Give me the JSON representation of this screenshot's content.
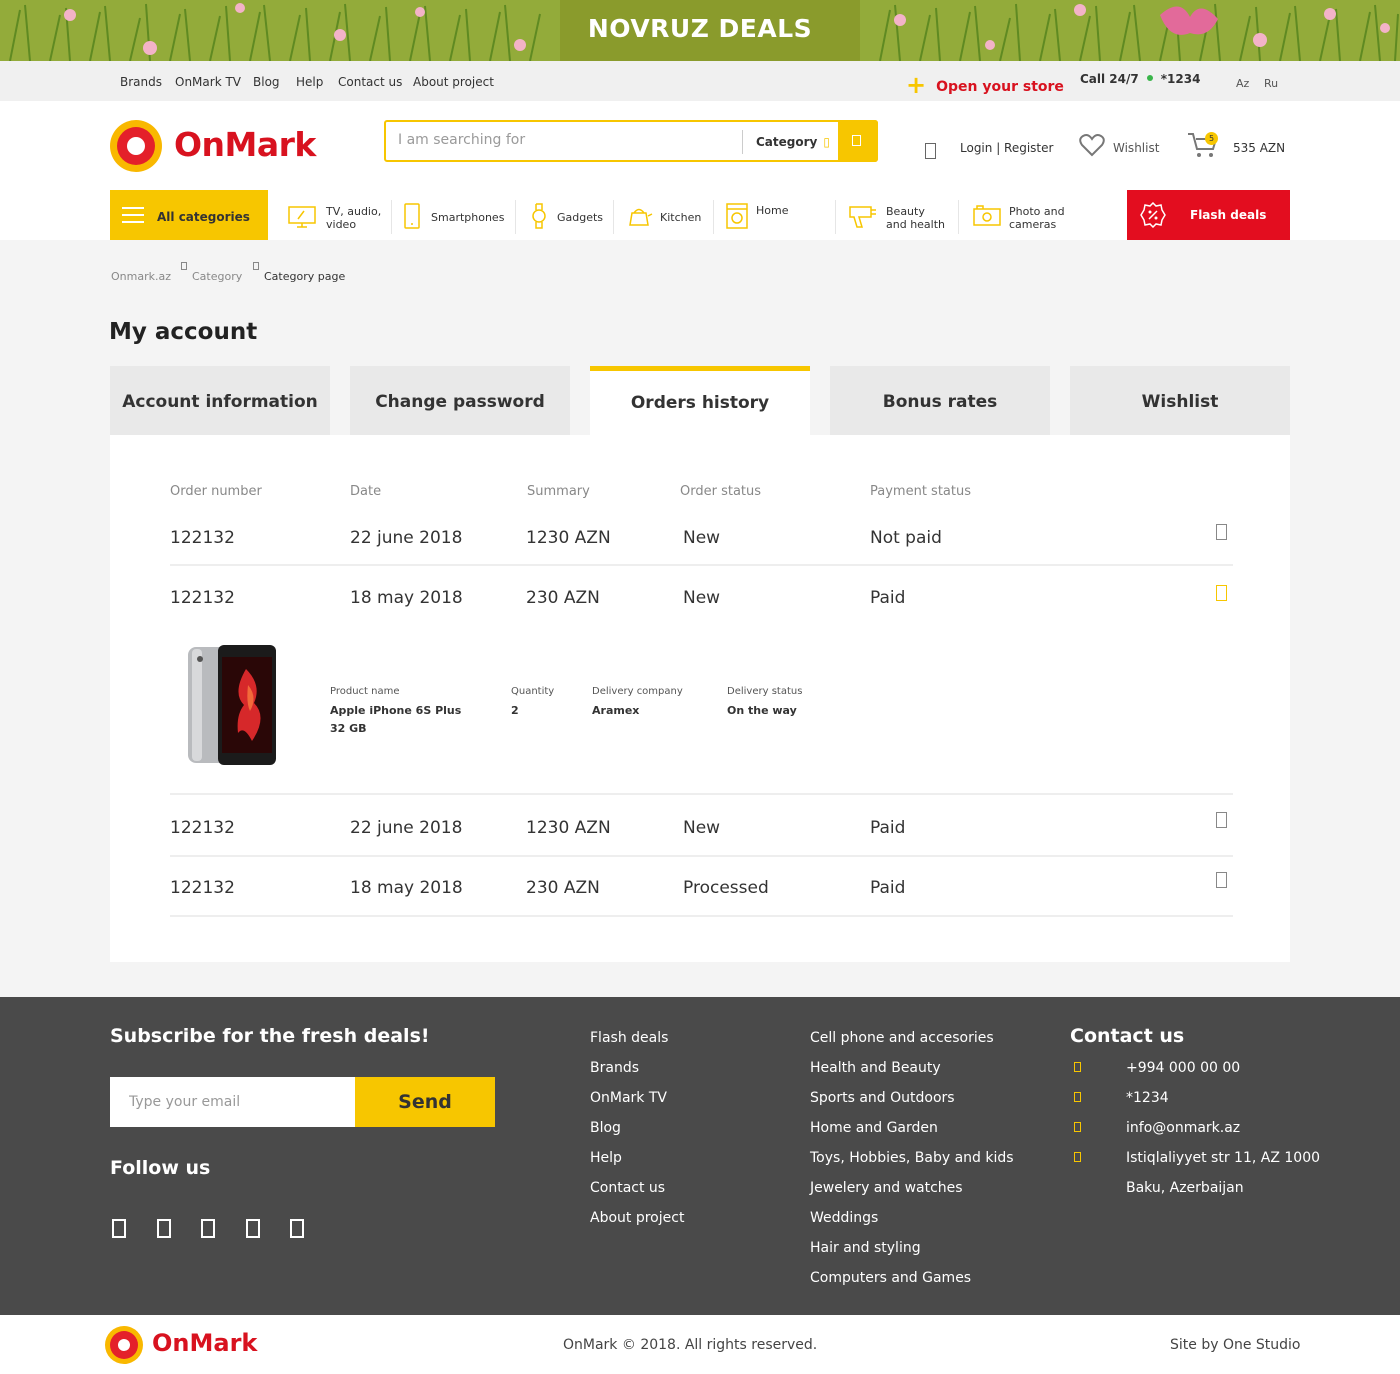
{
  "banner": {
    "title": "NOVRUZ DEALS"
  },
  "topbar": {
    "links": [
      "Brands",
      "OnMark TV",
      "Blog",
      "Help",
      "Contact us",
      "About project"
    ],
    "open_store": "Open your store",
    "call_label": "Call 24/7",
    "call_number": "*1234",
    "languages": [
      "Az",
      "Ru"
    ]
  },
  "header": {
    "logo_text": "OnMark",
    "search_placeholder": "I am searching for",
    "search_category": "Category",
    "login_register": "Login | Register",
    "wishlist": "Wishlist",
    "cart_count": "5",
    "cart_total": "535 AZN"
  },
  "categories": {
    "all_label": "All categories",
    "items": [
      {
        "label": "TV, audio, video",
        "icon": "tv-icon"
      },
      {
        "label": "Smartphones",
        "icon": "smartphone-icon"
      },
      {
        "label": "Gadgets",
        "icon": "watch-icon"
      },
      {
        "label": "Kitchen",
        "icon": "kettle-icon"
      },
      {
        "label": "Home",
        "icon": "washing-machine-icon"
      },
      {
        "label": "Beauty and health",
        "icon": "hair-dryer-icon"
      },
      {
        "label": "Photo and cameras",
        "icon": "camera-icon"
      }
    ],
    "flash_label": "Flash deals"
  },
  "breadcrumb": [
    "Onmark.az",
    "Category",
    "Category page"
  ],
  "page_title": "My account",
  "tabs": [
    "Account information",
    "Change password",
    "Orders history",
    "Bonus rates",
    "Wishlist"
  ],
  "orders": {
    "headers": [
      "Order number",
      "Date",
      "Summary",
      "Order status",
      "Payment status"
    ],
    "rows": [
      {
        "number": "122132",
        "date": "22 june 2018",
        "summary": "1230 AZN",
        "status": "New",
        "payment": "Not paid"
      },
      {
        "number": "122132",
        "date": "18 may 2018",
        "summary": "230 AZN",
        "status": "New",
        "payment": "Paid"
      },
      {
        "number": "122132",
        "date": "22 june 2018",
        "summary": "1230 AZN",
        "status": "New",
        "payment": "Paid"
      },
      {
        "number": "122132",
        "date": "18 may 2018",
        "summary": "230 AZN",
        "status": "Processed",
        "payment": "Paid"
      }
    ],
    "detail": {
      "product_label": "Product name",
      "product_name_1": "Apple iPhone 6S Plus",
      "product_name_2": "32 GB",
      "quantity_label": "Quantity",
      "quantity": "2",
      "company_label": "Delivery company",
      "company": "Aramex",
      "status_label": "Delivery status",
      "status": "On the way"
    }
  },
  "footer": {
    "subscribe_title": "Subscribe for the fresh deals!",
    "email_placeholder": "Type your email",
    "send_label": "Send",
    "follow_title": "Follow us",
    "links_1": [
      "Flash deals",
      "Brands",
      "OnMark TV",
      "Blog",
      "Help",
      "Contact us",
      "About project"
    ],
    "links_2": [
      "Cell phone and accesories",
      "Health and Beauty",
      "Sports and Outdoors",
      "Home and Garden",
      "Toys, Hobbies, Baby and kids",
      "Jewelery and watches",
      "Weddings",
      "Hair and styling",
      "Computers and Games"
    ],
    "contact_title": "Contact us",
    "contacts": [
      "+994 000 00 00",
      "*1234",
      "info@onmark.az",
      "Istiqlaliyyet str 11, AZ 1000",
      "Baku, Azerbaijan"
    ]
  },
  "bottom": {
    "logo_text": "OnMark",
    "copyright": "OnMark © 2018. All rights reserved.",
    "site_by": "Site by One Studio"
  },
  "colors": {
    "accent": "#f7c600",
    "brand_red": "#d8121f",
    "flash": "#e30d1f",
    "footer_bg": "#4a4a4a"
  }
}
